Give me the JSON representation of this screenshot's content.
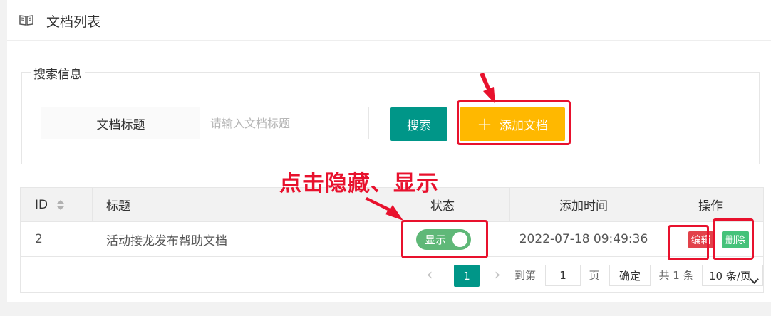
{
  "header": {
    "title": "文档列表",
    "icon": "book-icon"
  },
  "search": {
    "legend": "搜索信息",
    "field_label": "文档标题",
    "placeholder": "请输入文档标题",
    "value": "",
    "search_button": "搜索",
    "add_button": "添加文档"
  },
  "annotation": {
    "text": "点击隐藏、显示"
  },
  "table": {
    "columns": [
      "ID",
      "标题",
      "状态",
      "添加时间",
      "操作"
    ],
    "rows": [
      {
        "id": "2",
        "title": "活动接龙发布帮助文档",
        "status": "显示",
        "added": "2022-07-18 09:49:36",
        "edit": "编辑",
        "delete": "删除"
      }
    ]
  },
  "pagination": {
    "current_page": "1",
    "goto_label": "到第",
    "goto_value": "1",
    "page_unit": "页",
    "confirm": "确定",
    "total": "共 1 条",
    "page_size": "10 条/页"
  },
  "colors": {
    "primary": "#009688",
    "warm": "#ffb800",
    "switch_on": "#5fb878",
    "danger": "#e2424a",
    "success": "#45c27a",
    "annotation_red": "#e8112d"
  }
}
